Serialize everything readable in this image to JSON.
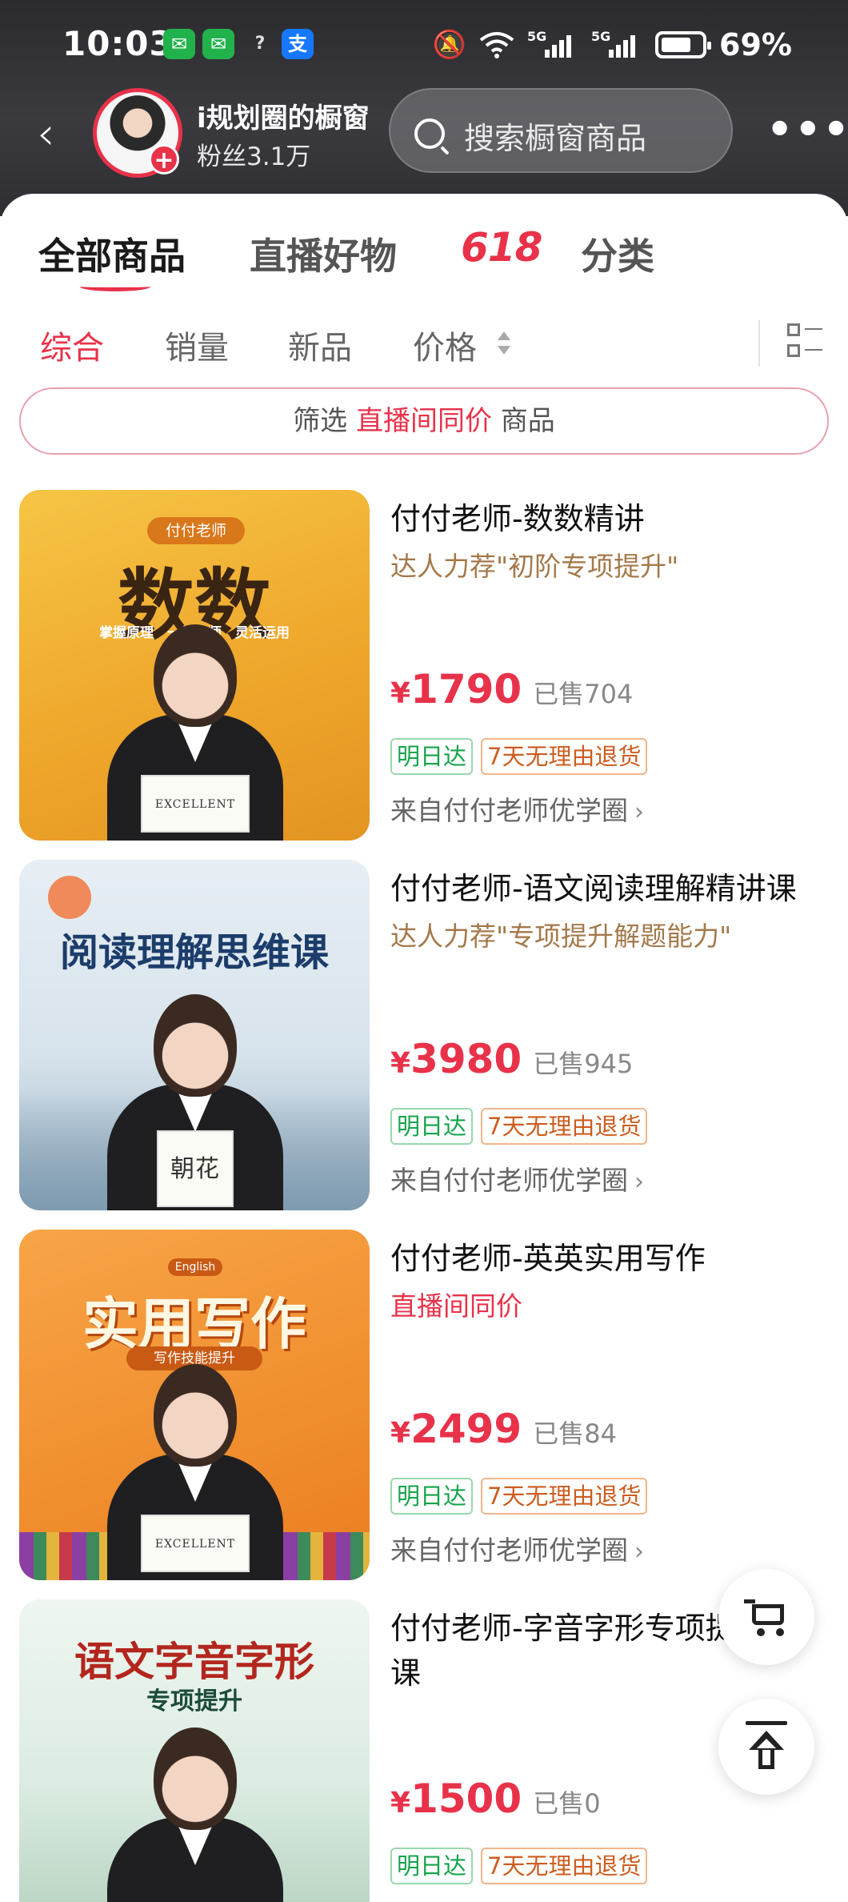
{
  "status_bar": {
    "time": "10:03",
    "alipay_label": "支",
    "question": "?",
    "battery_text": "69%",
    "signal_1": "5G",
    "signal_2": "5G",
    "icons": [
      "wechat-icon",
      "wechat-icon",
      "alipay-icon",
      "mute-icon",
      "wifi-icon",
      "signal-icon",
      "battery-icon"
    ]
  },
  "header": {
    "shop_name": "i规划圈的橱窗",
    "fans": "粉丝3.1万",
    "search_placeholder": "搜索橱窗商品",
    "back_icon": "chevron-left-icon",
    "more_icon": "more-icon"
  },
  "tabs": [
    {
      "label": "全部商品",
      "active": true
    },
    {
      "label": "直播好物",
      "active": false
    },
    {
      "label": "618",
      "active": false
    },
    {
      "label": "分类",
      "active": false
    }
  ],
  "sorts": [
    {
      "label": "综合",
      "active": true
    },
    {
      "label": "销量",
      "active": false
    },
    {
      "label": "新品",
      "active": false
    },
    {
      "label": "价格",
      "active": false
    }
  ],
  "filter": {
    "prefix": "筛选",
    "highlight": "直播间同价",
    "suffix": "商品"
  },
  "products": [
    {
      "title": "付付老师-数数精讲",
      "subtitle": "达人力荐\"初阶专项提升\"",
      "subtitle_type": "rec",
      "currency": "¥",
      "price": "1790",
      "sold": "已售704",
      "badge_delivery": "明日达",
      "badge_return": "7天无理由退货",
      "source": "来自付付老师优学圈",
      "thumb_title": "数数",
      "thumb_tag": "付付老师",
      "thumb_points": "掌握原理　一线名师　灵活运用",
      "thumb_paper": "EXCELLENT"
    },
    {
      "title": "付付老师-语文阅读理解精讲课",
      "subtitle": "达人力荐\"专项提升解题能力\"",
      "subtitle_type": "rec",
      "currency": "¥",
      "price": "3980",
      "sold": "已售945",
      "badge_delivery": "明日达",
      "badge_return": "7天无理由退货",
      "source": "来自付付老师优学圈",
      "thumb_title": "阅读理解思维课",
      "thumb_paper": "朝花"
    },
    {
      "title": "付付老师-英英实用写作",
      "subtitle": "直播间同价",
      "subtitle_type": "live",
      "currency": "¥",
      "price": "2499",
      "sold": "已售84",
      "badge_delivery": "明日达",
      "badge_return": "7天无理由退货",
      "source": "来自付付老师优学圈",
      "thumb_tag": "English",
      "thumb_title": "实用写作",
      "thumb_sub": "写作技能提升",
      "thumb_paper": "EXCELLENT"
    },
    {
      "title": "付付老师-字音字形专项提升课",
      "subtitle": "",
      "subtitle_type": "",
      "currency": "¥",
      "price": "1500",
      "sold": "已售0",
      "badge_delivery": "明日达",
      "badge_return": "7天无理由退货",
      "thumb_title": "语文字音字形",
      "thumb_sub": "专项提升"
    }
  ],
  "floating": {
    "cart_icon": "cart-icon",
    "top_icon": "back-to-top-icon"
  },
  "colors": {
    "accent": "#e8324a",
    "recommend": "#a4794a",
    "badge_green": "#14a34a",
    "badge_orange": "#cc5d1f",
    "header_bg": "#2f2f34"
  }
}
